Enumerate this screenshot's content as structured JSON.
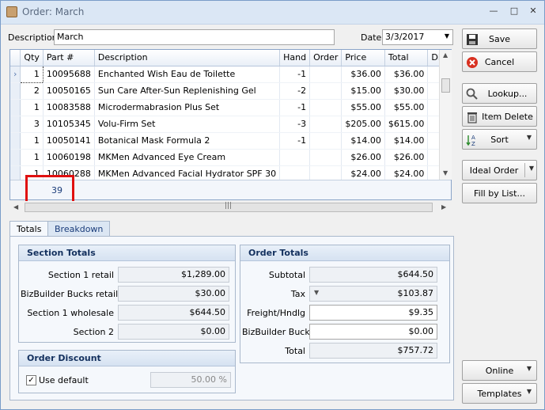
{
  "window": {
    "title": "Order: March",
    "controls": [
      "—",
      "□",
      "✕"
    ]
  },
  "form": {
    "description_label": "Description",
    "description_value": "March",
    "date_label": "Date",
    "date_value": "3/3/2017"
  },
  "grid": {
    "columns": [
      "Qty",
      "Part #",
      "Description",
      "Hand",
      "Order",
      "Price",
      "Total",
      "Discount%"
    ],
    "rows": [
      {
        "qty": "1",
        "part": "10095688",
        "desc": "Enchanted Wish Eau de Toilette",
        "hand": "-1",
        "order": "",
        "price": "$36.00",
        "total": "$36.00",
        "disc": ""
      },
      {
        "qty": "2",
        "part": "10050165",
        "desc": "Sun Care After-Sun Replenishing Gel",
        "hand": "-2",
        "order": "",
        "price": "$15.00",
        "total": "$30.00",
        "disc": ""
      },
      {
        "qty": "1",
        "part": "10083588",
        "desc": "Microdermabrasion Plus Set",
        "hand": "-1",
        "order": "",
        "price": "$55.00",
        "total": "$55.00",
        "disc": ""
      },
      {
        "qty": "3",
        "part": "10105345",
        "desc": "Volu-Firm Set",
        "hand": "-3",
        "order": "",
        "price": "$205.00",
        "total": "$615.00",
        "disc": ""
      },
      {
        "qty": "1",
        "part": "10050141",
        "desc": "Botanical Mask Formula 2",
        "hand": "-1",
        "order": "",
        "price": "$14.00",
        "total": "$14.00",
        "disc": ""
      },
      {
        "qty": "1",
        "part": "10060198",
        "desc": "MKMen Advanced Eye Cream",
        "hand": "",
        "order": "",
        "price": "$26.00",
        "total": "$26.00",
        "disc": ""
      },
      {
        "qty": "1",
        "part": "10060288",
        "desc": "MKMen Advanced Facial Hydrator SPF 30",
        "hand": "",
        "order": "",
        "price": "$24.00",
        "total": "$24.00",
        "disc": ""
      }
    ],
    "qty_total": "39"
  },
  "buttons": {
    "save": "Save",
    "cancel": "Cancel",
    "lookup": "Lookup...",
    "item_delete": "Item Delete",
    "sort": "Sort",
    "ideal_order": "Ideal Order",
    "fill_by_list": "Fill by List...",
    "online": "Online",
    "templates": "Templates"
  },
  "tabs": [
    "Totals",
    "Breakdown"
  ],
  "section_totals": {
    "title": "Section Totals",
    "rows": [
      {
        "label": "Section 1 retail",
        "value": "$1,289.00"
      },
      {
        "label": "BizBuilder Bucks retail",
        "value": "$30.00"
      },
      {
        "label": "Section 1 wholesale",
        "value": "$644.50"
      },
      {
        "label": "Section 2",
        "value": "$0.00"
      }
    ]
  },
  "order_discount": {
    "title": "Order Discount",
    "use_default_label": "Use default",
    "use_default_checked": true,
    "value": "50.00 %"
  },
  "order_totals": {
    "title": "Order Totals",
    "rows": [
      {
        "label": "Subtotal",
        "value": "$644.50"
      },
      {
        "label": "Tax",
        "value": "$103.87"
      },
      {
        "label": "Freight/Hndlg",
        "value": "$9.35"
      },
      {
        "label": "BizBuilder Bucks",
        "value": "$0.00"
      },
      {
        "label": "Total",
        "value": "$757.72"
      }
    ]
  },
  "colors": {
    "accent": "#1a3c7a",
    "highlight": "#e01010",
    "cancel": "#d83020"
  }
}
